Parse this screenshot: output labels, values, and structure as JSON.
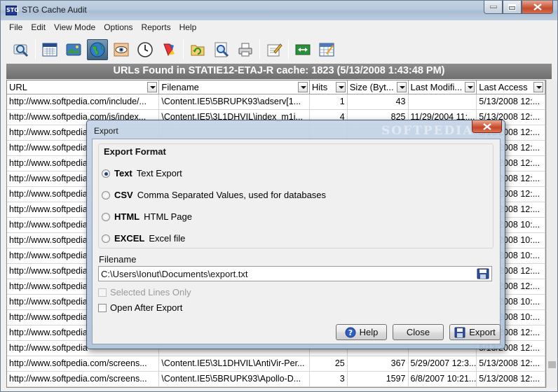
{
  "window": {
    "title": "STG Cache Audit",
    "icon_text": "STG"
  },
  "menu": [
    "File",
    "Edit",
    "View Mode",
    "Options",
    "Reports",
    "Help"
  ],
  "toolbar": {
    "buttons": [
      "search-icon",
      "calendar-icon",
      "landscape-icon",
      "globe-icon",
      "eye-icon",
      "clock-icon",
      "paint-icon",
      "refresh-folder-icon",
      "magnifier-icon",
      "printer-icon",
      "edit-icon",
      "expand-icon",
      "grid-icon"
    ],
    "active": "globe-icon"
  },
  "banner": "URLs Found in STATIE12-ETAJ-R cache: 1823 (5/13/2008 1:43:48 PM)",
  "grid": {
    "columns": [
      "URL",
      "Filename",
      "Hits",
      "Size (Byt...",
      "Last Modifi...",
      "Last Access"
    ],
    "rows": [
      [
        "http://www.softpedia.com/include/...",
        "\\Content.IE5\\5BRUPK93\\adserv[1...",
        "1",
        "43",
        "",
        "5/13/2008 12:..."
      ],
      [
        "http://www.softpedia.com/js/index...",
        "\\Content.IE5\\3L1DHVIL\\index_m1i...",
        "4",
        "825",
        "11/29/2004 11:...",
        "5/13/2008 12:..."
      ],
      [
        "http://www.softpedia",
        "",
        "",
        "",
        "",
        "5/13/2008 12:..."
      ],
      [
        "http://www.softpedia",
        "",
        "",
        "",
        "",
        "5/13/2008 12:..."
      ],
      [
        "http://www.softpedia",
        "",
        "",
        "",
        "",
        "5/13/2008 12:..."
      ],
      [
        "http://www.softpedia",
        "",
        "",
        "",
        "",
        "5/13/2008 12:..."
      ],
      [
        "http://www.softpedia",
        "",
        "",
        "",
        "",
        "5/13/2008 12:..."
      ],
      [
        "http://www.softpedia",
        "",
        "",
        "",
        "",
        "5/13/2008 12:..."
      ],
      [
        "http://www.softpedia",
        "",
        "",
        "",
        "",
        "5/13/2008 10:..."
      ],
      [
        "http://www.softpedia",
        "",
        "",
        "",
        "",
        "5/13/2008 10:..."
      ],
      [
        "http://www.softpedia",
        "",
        "",
        "",
        "",
        "5/13/2008 10:..."
      ],
      [
        "http://www.softpedia",
        "",
        "",
        "",
        "",
        "5/13/2008 12:..."
      ],
      [
        "http://www.softpedia",
        "",
        "",
        "",
        "",
        "5/13/2008 12:..."
      ],
      [
        "http://www.softpedia",
        "",
        "",
        "",
        "",
        "5/13/2008 10:..."
      ],
      [
        "http://www.softpedia",
        "",
        "",
        "",
        "",
        "5/13/2008 10:..."
      ],
      [
        "http://www.softpedia",
        "",
        "",
        "",
        "",
        "5/13/2008 12:..."
      ],
      [
        "http://www.softpedia",
        "",
        "",
        "",
        "",
        "5/13/2008 12:..."
      ],
      [
        "http://www.softpedia.com/screens...",
        "\\Content.IE5\\3L1DHVIL\\AntiVir-Per...",
        "25",
        "367",
        "5/29/2007 12:3...",
        "5/13/2008 12:..."
      ],
      [
        "http://www.softpedia.com/screens...",
        "\\Content.IE5\\5BRUPK93\\Apollo-D...",
        "3",
        "1597",
        "6/8/2007 10:21...",
        "5/13/2008 12:..."
      ]
    ]
  },
  "dialog": {
    "title": "Export",
    "watermark": "SOFTPEDIA",
    "group_label": "Export Format",
    "formats": [
      {
        "name": "Text",
        "desc": "Text Export",
        "selected": true
      },
      {
        "name": "CSV",
        "desc": "Comma Separated Values, used for databases",
        "selected": false
      },
      {
        "name": "HTML",
        "desc": "HTML Page",
        "selected": false
      },
      {
        "name": "EXCEL",
        "desc": "Excel file",
        "selected": false
      }
    ],
    "filename_label": "Filename",
    "filename_value": "C:\\Users\\Ionut\\Documents\\export.txt",
    "selected_lines_label": "Selected Lines Only",
    "open_after_label": "Open After Export",
    "help_label": "Help",
    "close_label": "Close",
    "export_label": "Export"
  }
}
